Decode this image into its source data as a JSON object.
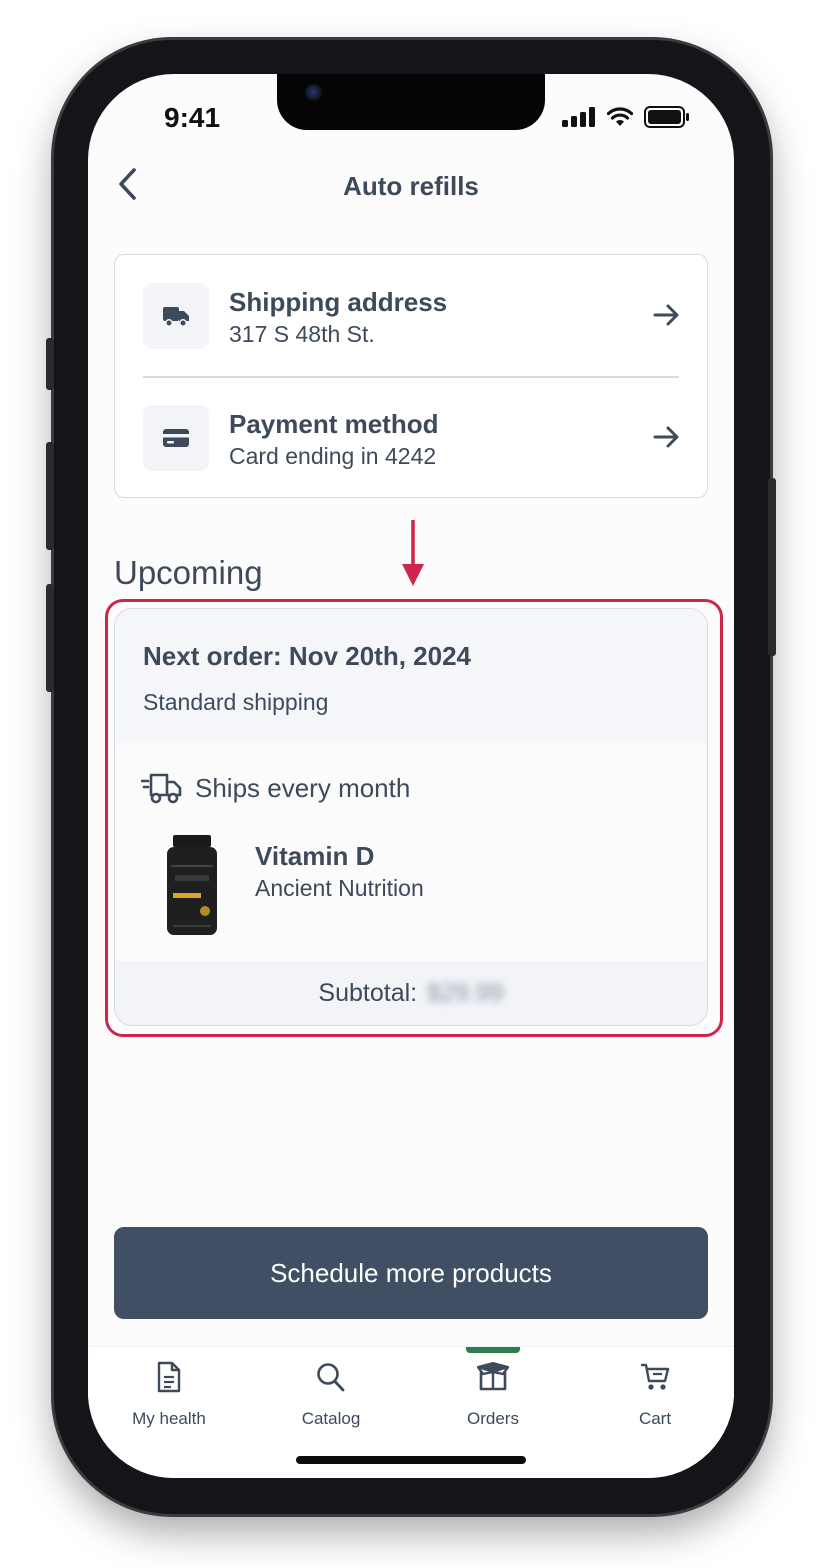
{
  "status_bar": {
    "time": "9:41"
  },
  "header": {
    "title": "Auto refills"
  },
  "info_card": {
    "shipping": {
      "title": "Shipping address",
      "subtitle": "317 S 48th St."
    },
    "payment": {
      "title": "Payment method",
      "subtitle": "Card ending in 4242"
    }
  },
  "upcoming": {
    "section_title": "Upcoming",
    "next_order": "Next order: Nov 20th, 2024",
    "shipping_method": "Standard shipping",
    "frequency": "Ships every month",
    "product": {
      "name": "Vitamin D",
      "brand": "Ancient Nutrition"
    },
    "subtotal_label": "Subtotal:",
    "subtotal_value": "$29.99"
  },
  "cta": {
    "label": "Schedule more products"
  },
  "tabs": [
    {
      "label": "My health",
      "icon": "document-icon"
    },
    {
      "label": "Catalog",
      "icon": "search-icon"
    },
    {
      "label": "Orders",
      "icon": "box-icon",
      "active": true
    },
    {
      "label": "Cart",
      "icon": "cart-icon"
    }
  ],
  "colors": {
    "text": "#3e4a5a",
    "cta_background": "#414f64",
    "highlight_border": "#d0254a",
    "active_tab_indicator": "#2f7d4f"
  }
}
